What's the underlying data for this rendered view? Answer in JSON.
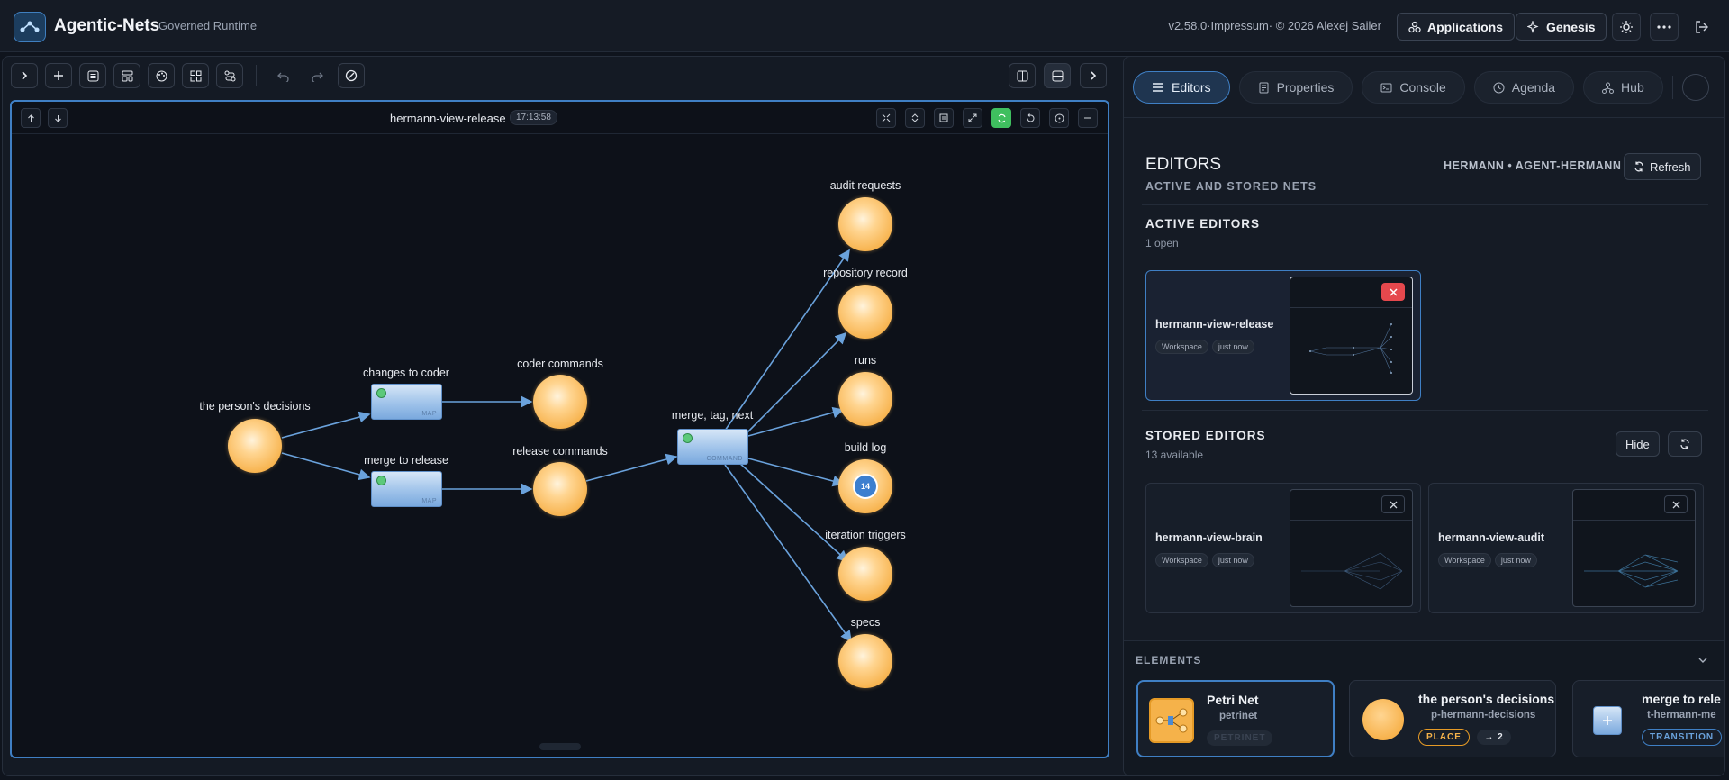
{
  "header": {
    "app_title": "Agentic-Nets",
    "app_subtitle": "Governed Runtime",
    "version": "v2.58.0·Impressum· © 2026 Alexej Sailer",
    "applications_label": "Applications",
    "genesis_label": "Genesis"
  },
  "editor": {
    "title": "hermann-view-release",
    "time": "17:13:58",
    "places": [
      {
        "label": "the person's decisions"
      },
      {
        "label": "coder commands"
      },
      {
        "label": "release commands"
      },
      {
        "label": "audit requests"
      },
      {
        "label": "repository record"
      },
      {
        "label": "runs"
      },
      {
        "label": "build log",
        "tokens": "14"
      },
      {
        "label": "iteration triggers"
      },
      {
        "label": "specs"
      }
    ],
    "transitions": [
      {
        "label": "changes to coder",
        "kind": "MAP"
      },
      {
        "label": "merge to release",
        "kind": "MAP"
      },
      {
        "label": "merge, tag, next",
        "kind": "COMMAND"
      }
    ]
  },
  "panel": {
    "tabs": [
      "Editors",
      "Properties",
      "Console",
      "Agenda",
      "Hub"
    ],
    "title": "EDITORS",
    "subtitle": "ACTIVE AND STORED NETS",
    "user": "HERMANN • AGENT-HERMANN",
    "refresh_label": "Refresh",
    "active_title": "ACTIVE EDITORS",
    "active_count": "1 open",
    "active_card": {
      "name": "hermann-view-release",
      "chip1": "Workspace",
      "chip2": "just now"
    },
    "stored_title": "STORED EDITORS",
    "stored_count": "13 available",
    "hide_label": "Hide",
    "stored_cards": [
      {
        "name": "hermann-view-brain",
        "chip1": "Workspace",
        "chip2": "just now"
      },
      {
        "name": "hermann-view-audit",
        "chip1": "Workspace",
        "chip2": "just now"
      }
    ],
    "elements_title": "ELEMENTS",
    "elements": [
      {
        "name": "Petri Net",
        "id": "petrinet",
        "type": "PETRINET"
      },
      {
        "name": "the person's decisions",
        "id": "p-hermann-decisions",
        "type": "PLACE",
        "count": "→ 2"
      },
      {
        "name": "merge to rele",
        "id": "t-hermann-me",
        "type": "TRANSITION"
      }
    ]
  }
}
